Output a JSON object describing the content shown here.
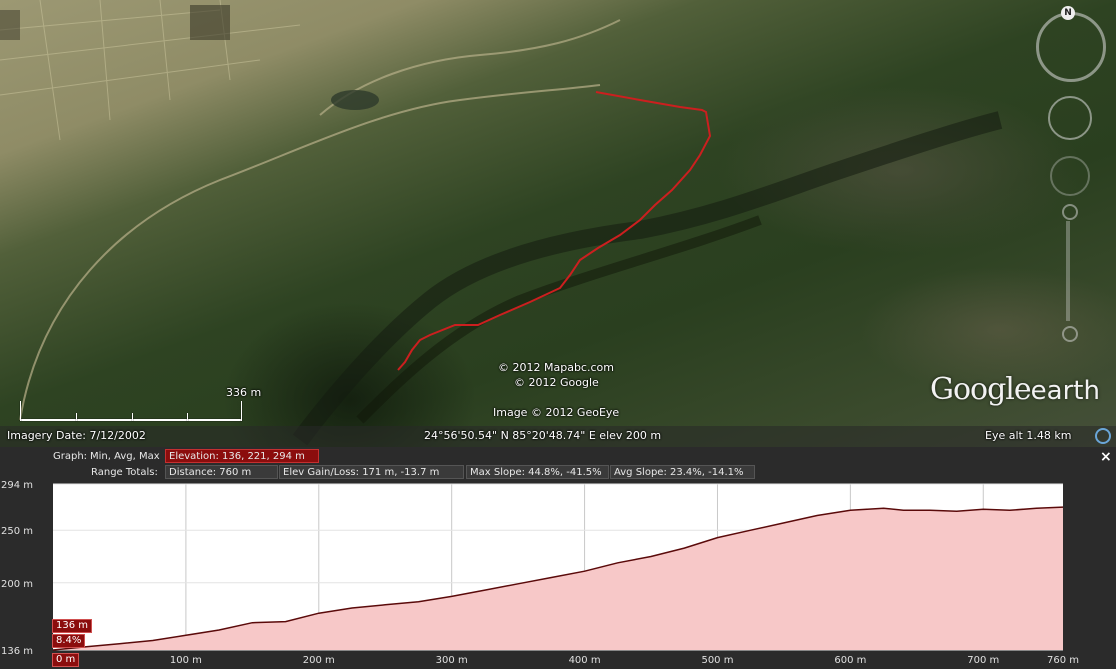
{
  "map": {
    "attribution_1": "© 2012 Mapabc.com",
    "attribution_2": "© 2012 Google",
    "attribution_3": "Image © 2012 GeoEye",
    "scale_label": "336 m",
    "logo_google": "Google",
    "logo_earth": "earth",
    "compass_letter": "N",
    "path_color": "#cc1f1f"
  },
  "status": {
    "imagery_date": "Imagery Date: 7/12/2002",
    "coordinates": "24°56'50.54\" N  85°20'48.74\" E  elev   200 m",
    "eye_alt": "Eye alt    1.48 km"
  },
  "profile": {
    "graph_label": "Graph:",
    "min_avg_max_label": "Min, Avg, Max",
    "elevation": "Elevation: 136, 221, 294 m",
    "range_totals_label": "Range Totals:",
    "distance": "Distance: 760 m",
    "elev_gain_loss": "Elev Gain/Loss: 171 m, -13.7 m",
    "max_slope": "Max Slope: 44.8%, -41.5%",
    "avg_slope": "Avg Slope: 23.4%, -14.1%",
    "close_label": "×",
    "cursor_elev": "136 m",
    "cursor_slope": "8.4%",
    "cursor_dist": "0 m"
  },
  "chart_data": {
    "type": "area",
    "title": "",
    "xlabel": "",
    "ylabel": "",
    "x_unit": "m",
    "y_unit": "m",
    "xlim": [
      0,
      760
    ],
    "ylim": [
      136,
      294
    ],
    "x_ticks": [
      "0 m",
      "100 m",
      "200 m",
      "300 m",
      "400 m",
      "500 m",
      "600 m",
      "700 m",
      "760 m"
    ],
    "x_tick_values": [
      0,
      100,
      200,
      300,
      400,
      500,
      600,
      700,
      760
    ],
    "y_ticks": [
      "136 m",
      "200 m",
      "250 m",
      "294 m"
    ],
    "y_tick_values": [
      136,
      200,
      250,
      294
    ],
    "grid": true,
    "fill_color": "#f7c8c8",
    "line_color": "#5a0a0a",
    "series": [
      {
        "x": [
          0,
          25,
          50,
          75,
          100,
          125,
          150,
          175,
          200,
          225,
          250,
          275,
          300,
          325,
          350,
          375,
          400,
          425,
          450,
          475,
          500,
          525,
          550,
          575,
          600,
          625,
          640,
          660,
          680,
          700,
          720,
          740,
          760
        ],
        "values": [
          136,
          139,
          142,
          145,
          150,
          155,
          162,
          163,
          171,
          176,
          179,
          182,
          187,
          193,
          199,
          205,
          211,
          219,
          225,
          233,
          243,
          250,
          257,
          264,
          269,
          271,
          269,
          269,
          268,
          270,
          269,
          271,
          272
        ]
      }
    ]
  }
}
